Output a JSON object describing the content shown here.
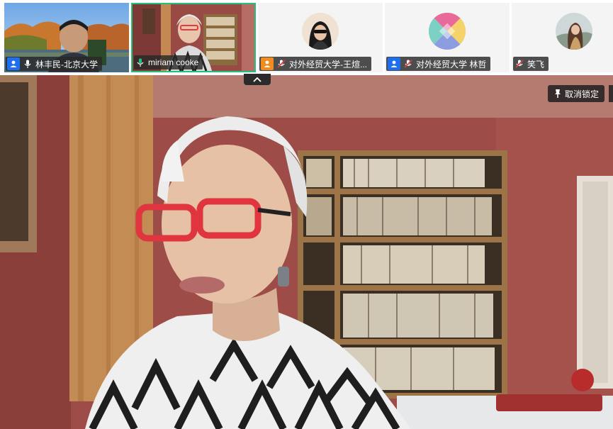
{
  "participants": [
    {
      "name": "林丰民-北京大学",
      "mic": "on",
      "role": "host",
      "type": "video"
    },
    {
      "name": "miriam cooke",
      "mic": "active",
      "role": "none",
      "type": "video",
      "speaking": true
    },
    {
      "name": "对外经贸大学-王煊...",
      "mic": "muted",
      "role": "cohost",
      "type": "avatar"
    },
    {
      "name": "对外经贸大学 林哲",
      "mic": "muted",
      "role": "host",
      "type": "avatar"
    },
    {
      "name": "笑飞",
      "mic": "muted",
      "role": "none",
      "type": "avatar"
    }
  ],
  "main": {
    "unpin_label": "取消锁定"
  },
  "colors": {
    "active_border": "#23c27a",
    "host_badge": "#1e6ef2",
    "cohost_badge": "#f28c1e",
    "muted_mic": "#e04040"
  }
}
